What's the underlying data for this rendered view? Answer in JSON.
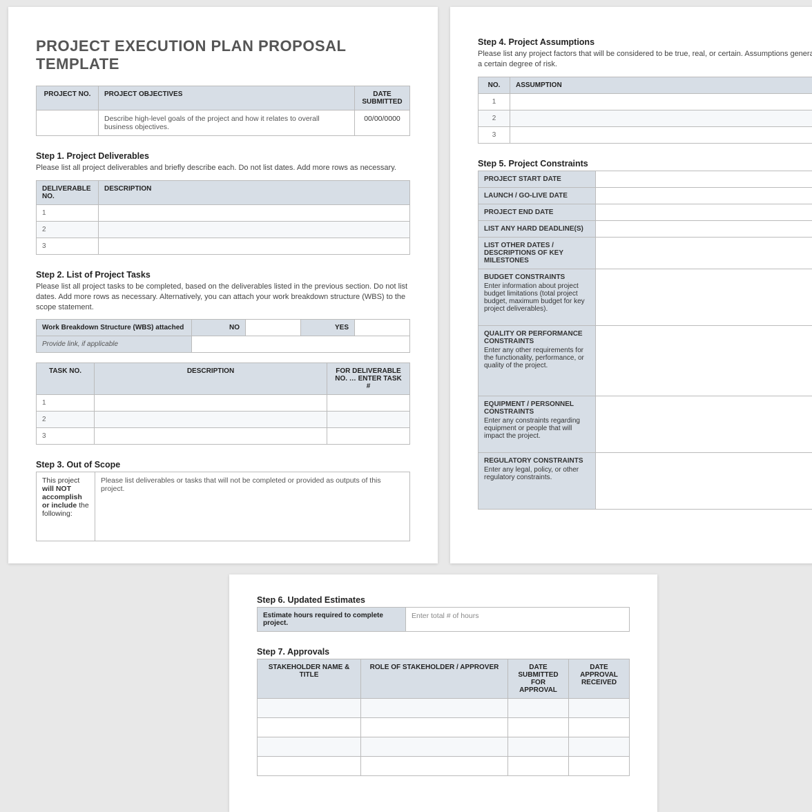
{
  "title": "PROJECT EXECUTION PLAN PROPOSAL TEMPLATE",
  "hdr": {
    "projno": "PROJECT NO.",
    "obj": "PROJECT OBJECTIVES",
    "date": "DATE SUBMITTED",
    "objtxt": "Describe high-level goals of the project and how it relates to overall business objectives.",
    "dateval": "00/00/0000"
  },
  "s1": {
    "t": "Step 1. Project Deliverables",
    "d": "Please list all project deliverables and briefly describe each. Do not list dates. Add more rows as necessary.",
    "c1": "DELIVERABLE NO.",
    "c2": "DESCRIPTION",
    "r": [
      "1",
      "2",
      "3"
    ]
  },
  "s2": {
    "t": "Step 2. List of Project Tasks",
    "d": "Please list all project tasks to be completed, based on the deliverables listed in the previous section. Do not list dates. Add more rows as necessary. Alternatively, you can attach your work breakdown structure (WBS) to the scope statement.",
    "wbs": "Work Breakdown Structure (WBS) attached",
    "no": "NO",
    "yes": "YES",
    "link": "Provide link, if applicable",
    "c1": "TASK NO.",
    "c2": "DESCRIPTION",
    "c3": "FOR DELIVERABLE NO. … ENTER TASK #",
    "r": [
      "1",
      "2",
      "3"
    ]
  },
  "s3": {
    "t": "Step 3. Out of Scope",
    "l1": "This project ",
    "l2": "will NOT accomplish or include",
    "l3": " the following:",
    "d": "Please list deliverables or tasks that will not be completed or provided as outputs of this project."
  },
  "s4": {
    "t": "Step 4. Project Assumptions",
    "d": "Please list any project factors that will be considered to be true, real, or certain. Assumptions generally involve a certain degree of risk.",
    "c1": "NO.",
    "c2": "ASSUMPTION",
    "r": [
      "1",
      "2",
      "3"
    ]
  },
  "s5": {
    "t": "Step 5. Project Constraints",
    "start": "PROJECT START DATE",
    "launch": "LAUNCH / GO-LIVE DATE",
    "end": "PROJECT END DATE",
    "hard": "LIST ANY HARD DEADLINE(S)",
    "mile": "LIST OTHER DATES / DESCRIPTIONS OF KEY MILESTONES",
    "budget": "BUDGET CONSTRAINTS",
    "budgetd": "Enter information about project budget limitations (total project budget, maximum budget for key project deliverables).",
    "qual": "QUALITY OR PERFORMANCE CONSTRAINTS",
    "quald": "Enter any other requirements for the functionality, performance, or quality of the project.",
    "eq": "EQUIPMENT / PERSONNEL CONSTRAINTS",
    "eqd": "Enter any constraints regarding equipment or people that will impact the project.",
    "reg": "REGULATORY CONSTRAINTS",
    "regd": "Enter any legal, policy, or other regulatory constraints."
  },
  "s6": {
    "t": "Step 6. Updated Estimates",
    "l": "Estimate hours required to complete project.",
    "p": "Enter total # of hours"
  },
  "s7": {
    "t": "Step 7. Approvals",
    "c1": "STAKEHOLDER NAME & TITLE",
    "c2": "ROLE OF STAKEHOLDER / APPROVER",
    "c3": "DATE SUBMITTED FOR APPROVAL",
    "c4": "DATE APPROVAL RECEIVED"
  }
}
